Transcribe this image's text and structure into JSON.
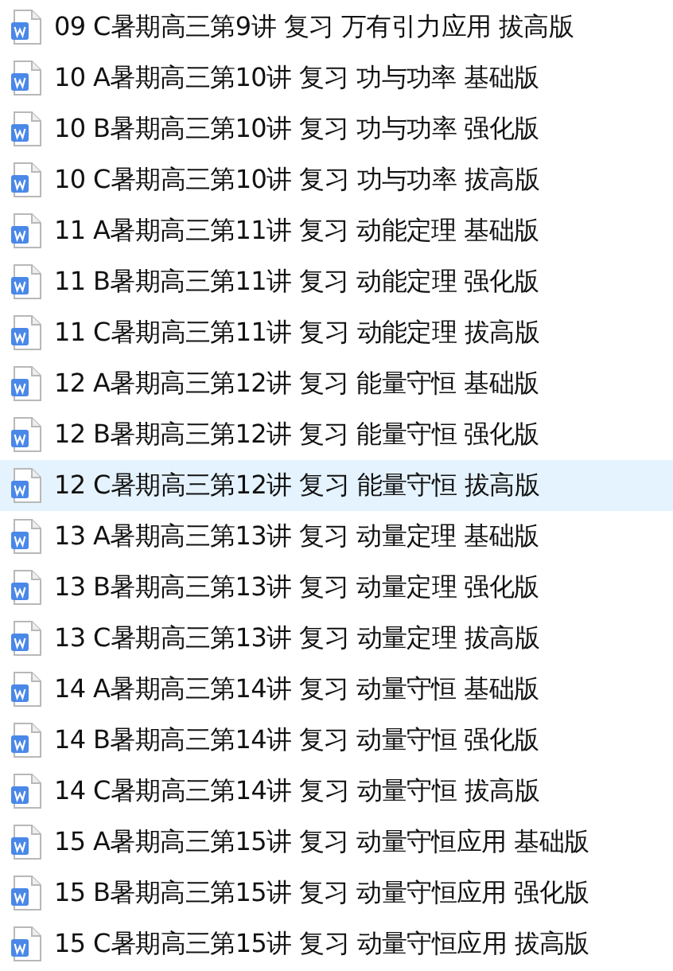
{
  "files": [
    {
      "name": "09 C暑期高三第9讲 复习 万有引力应用 拔高版",
      "selected": false
    },
    {
      "name": "10 A暑期高三第10讲 复习 功与功率 基础版",
      "selected": false
    },
    {
      "name": "10 B暑期高三第10讲 复习 功与功率 强化版",
      "selected": false
    },
    {
      "name": "10 C暑期高三第10讲 复习 功与功率 拔高版",
      "selected": false
    },
    {
      "name": "11 A暑期高三第11讲 复习 动能定理 基础版",
      "selected": false
    },
    {
      "name": "11 B暑期高三第11讲 复习 动能定理 强化版",
      "selected": false
    },
    {
      "name": "11 C暑期高三第11讲 复习 动能定理 拔高版",
      "selected": false
    },
    {
      "name": "12 A暑期高三第12讲 复习 能量守恒 基础版",
      "selected": false
    },
    {
      "name": "12 B暑期高三第12讲 复习 能量守恒 强化版",
      "selected": false
    },
    {
      "name": "12 C暑期高三第12讲 复习 能量守恒 拔高版",
      "selected": true
    },
    {
      "name": "13 A暑期高三第13讲 复习 动量定理 基础版",
      "selected": false
    },
    {
      "name": "13 B暑期高三第13讲 复习 动量定理 强化版",
      "selected": false
    },
    {
      "name": "13 C暑期高三第13讲 复习 动量定理 拔高版",
      "selected": false
    },
    {
      "name": "14 A暑期高三第14讲 复习 动量守恒 基础版",
      "selected": false
    },
    {
      "name": "14 B暑期高三第14讲 复习 动量守恒 强化版",
      "selected": false
    },
    {
      "name": "14 C暑期高三第14讲 复习 动量守恒 拔高版",
      "selected": false
    },
    {
      "name": "15 A暑期高三第15讲 复习 动量守恒应用 基础版",
      "selected": false
    },
    {
      "name": "15 B暑期高三第15讲 复习 动量守恒应用 强化版",
      "selected": false
    },
    {
      "name": "15 C暑期高三第15讲 复习 动量守恒应用 拔高版",
      "selected": false
    }
  ]
}
